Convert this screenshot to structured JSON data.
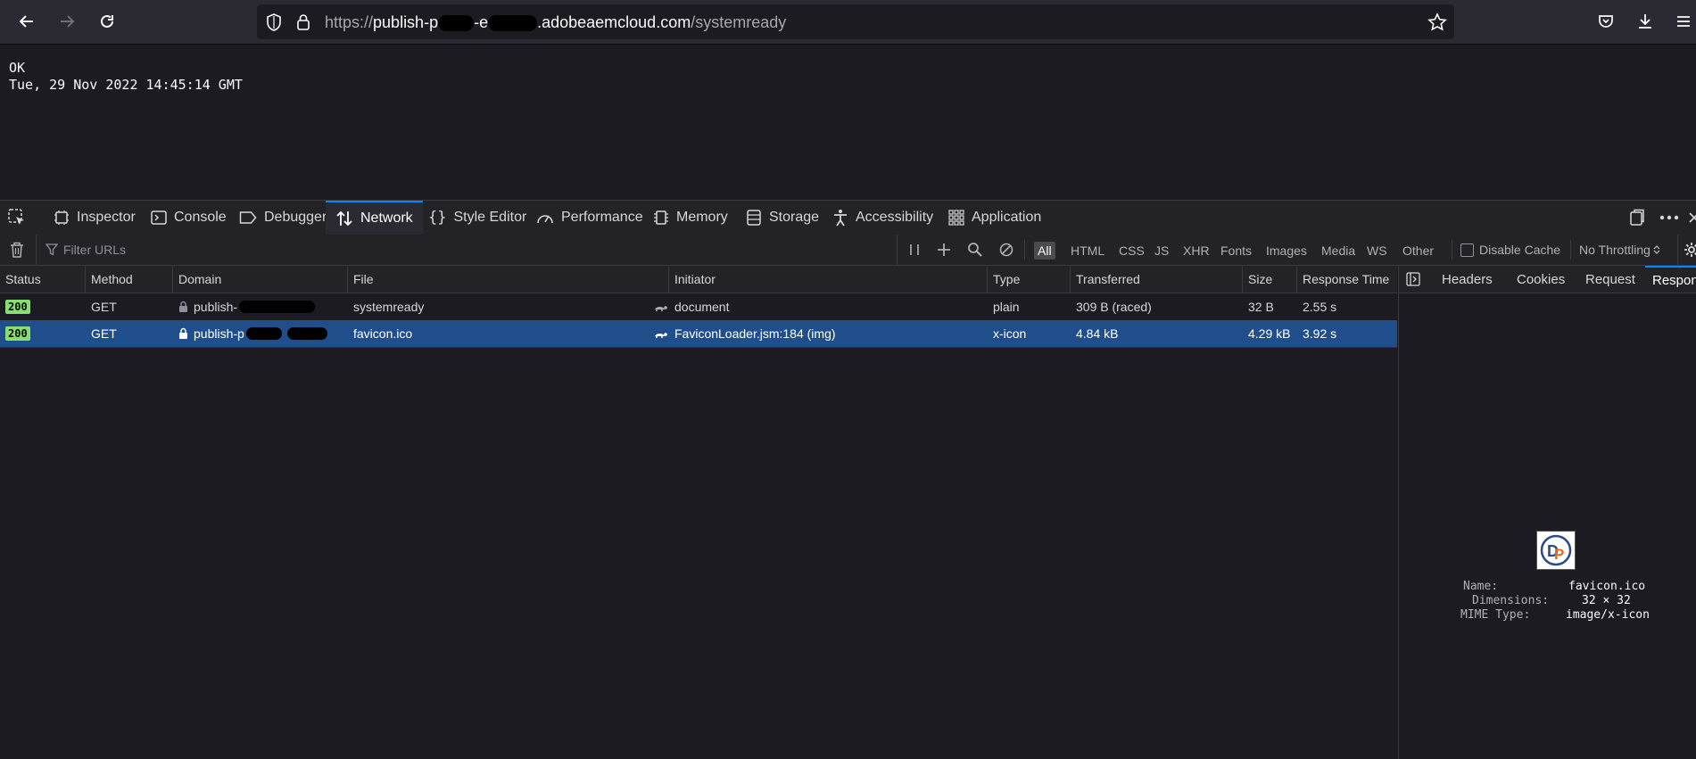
{
  "browser": {
    "url_prefix": "https://",
    "url_host_start": "publish-p",
    "url_host_mid": "-e",
    "url_host_end": ".adobeaemcloud.com",
    "url_path": "/systemready"
  },
  "page": {
    "line1": "OK",
    "line2": "Tue, 29 Nov 2022 14:45:14 GMT"
  },
  "devtools": {
    "tabs": [
      {
        "label": "Inspector",
        "icon": "inspector-icon"
      },
      {
        "label": "Console",
        "icon": "console-icon"
      },
      {
        "label": "Debugger",
        "icon": "debugger-icon"
      },
      {
        "label": "Network",
        "icon": "network-icon"
      },
      {
        "label": "Style Editor",
        "icon": "style-editor-icon"
      },
      {
        "label": "Performance",
        "icon": "performance-icon"
      },
      {
        "label": "Memory",
        "icon": "memory-icon"
      },
      {
        "label": "Storage",
        "icon": "storage-icon"
      },
      {
        "label": "Accessibility",
        "icon": "accessibility-icon"
      },
      {
        "label": "Application",
        "icon": "application-icon"
      }
    ],
    "filter_placeholder": "Filter URLs",
    "type_filters": [
      "All",
      "HTML",
      "CSS",
      "JS",
      "XHR",
      "Fonts",
      "Images",
      "Media",
      "WS",
      "Other"
    ],
    "disable_cache_label": "Disable Cache",
    "throttling_label": "No Throttling"
  },
  "table": {
    "columns": [
      "Status",
      "Method",
      "Domain",
      "File",
      "Initiator",
      "Type",
      "Transferred",
      "Size",
      "Response Time"
    ],
    "rows": [
      {
        "status": "200",
        "method": "GET",
        "domain": "publish-",
        "file": "systemready",
        "initiator": "document",
        "type": "plain",
        "transferred": "309 B (raced)",
        "size": "32 B",
        "time": "2.55 s"
      },
      {
        "status": "200",
        "method": "GET",
        "domain": "publish-p",
        "file": "favicon.ico",
        "initiator": "FaviconLoader.jsm:184 (img)",
        "type": "x-icon",
        "transferred": "4.84 kB",
        "size": "4.29 kB",
        "time": "3.92 s"
      }
    ]
  },
  "side_panel": {
    "tabs": [
      "Headers",
      "Cookies",
      "Request",
      "Respon"
    ],
    "name_label": "Name:",
    "name_value": "favicon.ico",
    "dim_label": "Dimensions:",
    "dim_value": "32 × 32",
    "mime_label": "MIME Type:",
    "mime_value": "image/x-icon",
    "preview_letters": "DP"
  }
}
